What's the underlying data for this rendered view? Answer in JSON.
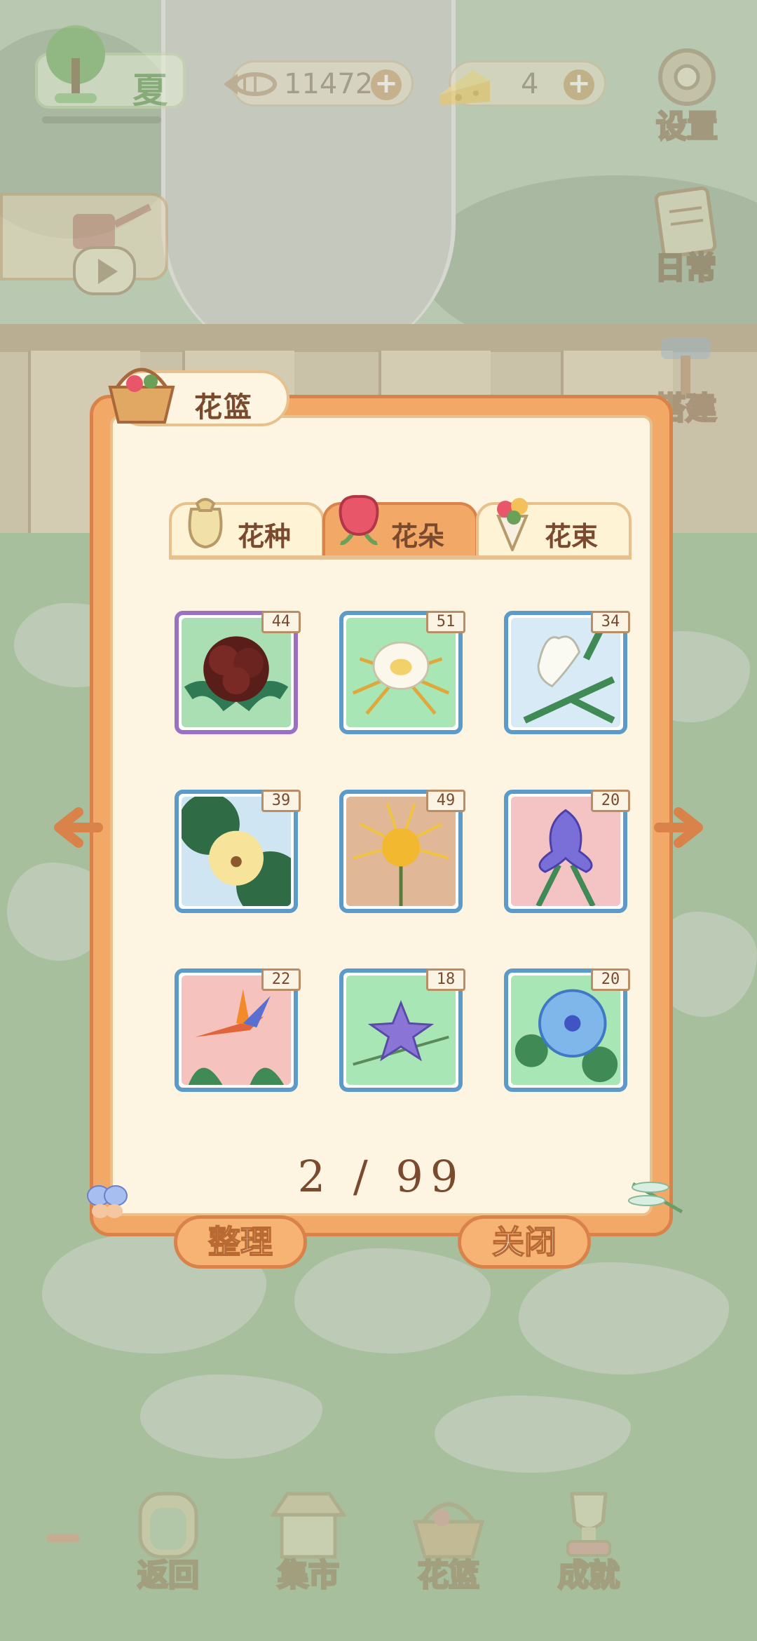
{
  "hud": {
    "season": "夏",
    "fish_bones": "11472",
    "cheese": "4",
    "plus": "+",
    "settings_label": "设置",
    "daily_label": "日常",
    "build_label": "搭建"
  },
  "dialog": {
    "title": "花篮",
    "tabs": [
      {
        "label": "花种",
        "active": false
      },
      {
        "label": "花朵",
        "active": true
      },
      {
        "label": "花束",
        "active": false
      }
    ],
    "items": [
      {
        "name": "peony",
        "count": "44"
      },
      {
        "name": "night-blooming-cereus",
        "count": "51"
      },
      {
        "name": "lily",
        "count": "34"
      },
      {
        "name": "water-poppy",
        "count": "39"
      },
      {
        "name": "spider-lily",
        "count": "49"
      },
      {
        "name": "iris",
        "count": "20"
      },
      {
        "name": "bird-of-paradise",
        "count": "22"
      },
      {
        "name": "balloon-flower",
        "count": "18"
      },
      {
        "name": "morning-glory",
        "count": "20"
      }
    ],
    "page_current": "2",
    "page_total": "99",
    "page_indicator": "2 / 99",
    "sort_button": "整理",
    "close_button": "关闭"
  },
  "bottom_nav": [
    {
      "label": "返回"
    },
    {
      "label": "集市"
    },
    {
      "label": "花篮"
    },
    {
      "label": "成就"
    }
  ],
  "colors": {
    "dialog_orange": "#f2a867",
    "paper": "#fdf5e1",
    "text_brown": "#7a4a2e",
    "card_blue": "#5b9ac9",
    "card_purple": "#9a6fc4"
  }
}
